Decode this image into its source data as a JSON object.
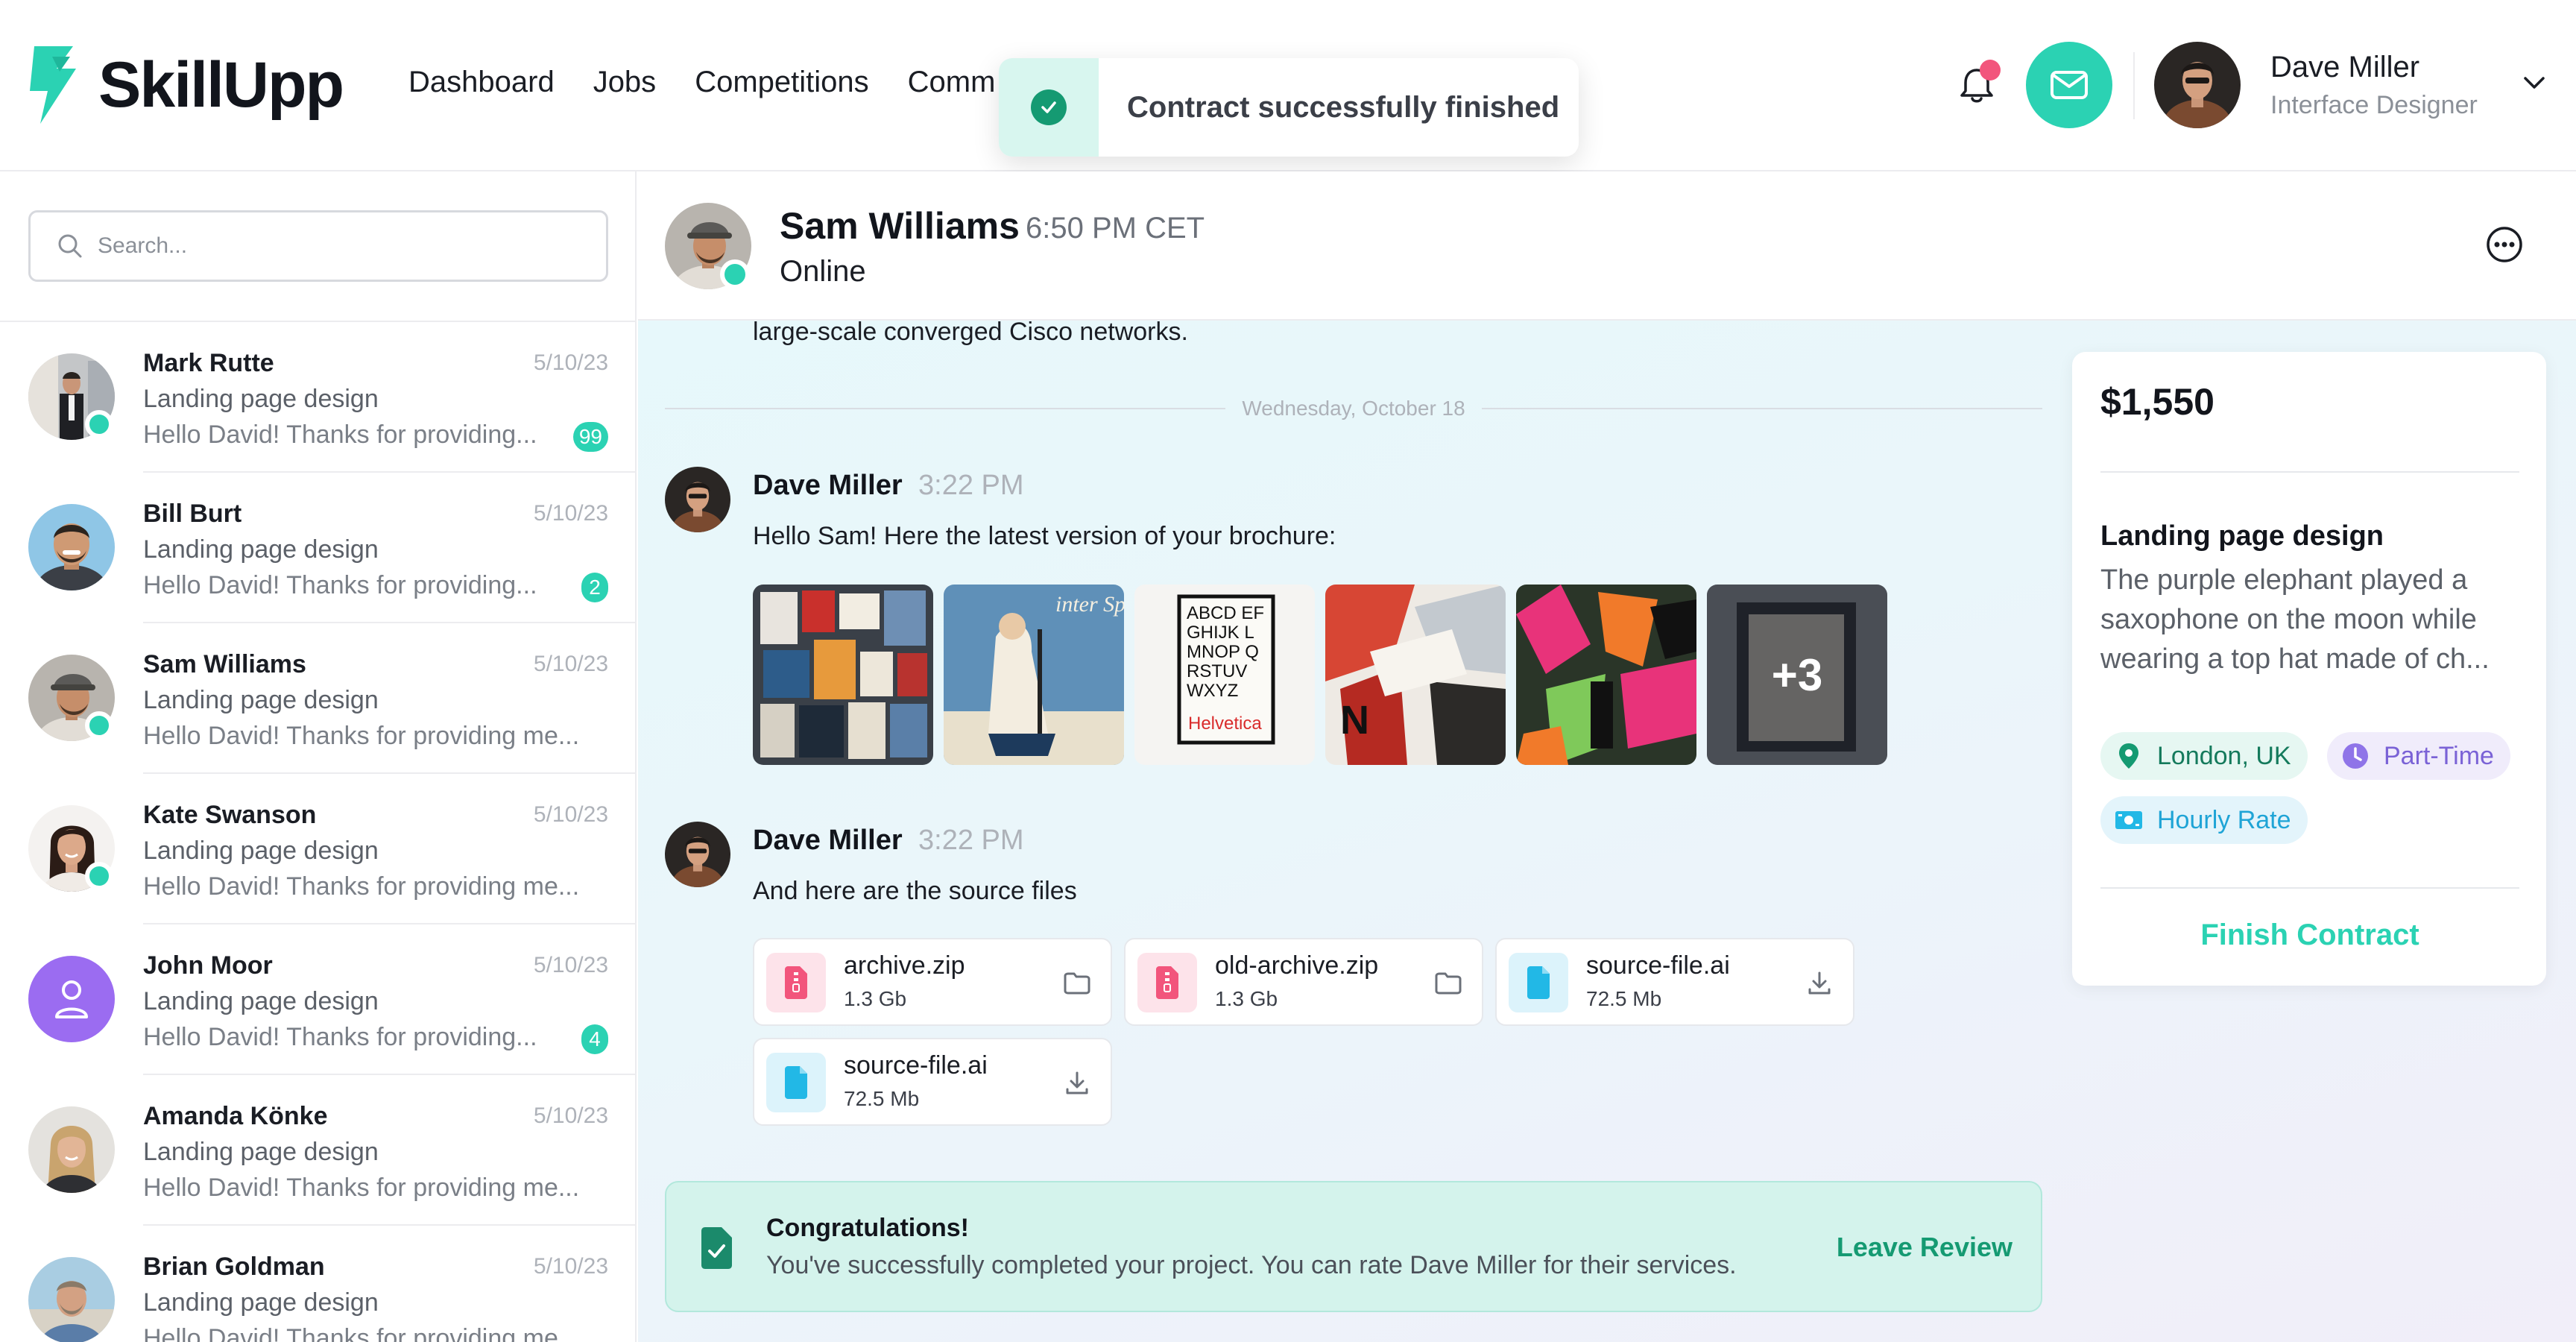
{
  "brand": {
    "name": "SkillUpp",
    "accent": "#2bd2b3",
    "accent_dark": "#159a72"
  },
  "nav": {
    "items": [
      "Dashboard",
      "Jobs",
      "Competitions",
      "Comm"
    ]
  },
  "toast": {
    "message": "Contract successfully finished"
  },
  "user": {
    "name": "Dave Miller",
    "role": "Interface Designer"
  },
  "sidebar": {
    "search_placeholder": "Search...",
    "conversations": [
      {
        "name": "Mark Rutte",
        "date": "5/10/23",
        "subject": "Landing page design",
        "preview": "Hello David! Thanks for providing...",
        "badge": "99",
        "online": true
      },
      {
        "name": "Bill Burt",
        "date": "5/10/23",
        "subject": "Landing page design",
        "preview": "Hello David! Thanks for providing...",
        "badge": "2",
        "online": false
      },
      {
        "name": "Sam Williams",
        "date": "5/10/23",
        "subject": "Landing page design",
        "preview": "Hello David! Thanks for providing me...",
        "badge": "",
        "online": true
      },
      {
        "name": "Kate Swanson",
        "date": "5/10/23",
        "subject": "Landing page design",
        "preview": "Hello David! Thanks for providing me...",
        "badge": "",
        "online": true
      },
      {
        "name": "John Moor",
        "date": "5/10/23",
        "subject": "Landing page design",
        "preview": "Hello David! Thanks for providing...",
        "badge": "4",
        "online": false
      },
      {
        "name": "Amanda Könke",
        "date": "5/10/23",
        "subject": "Landing page design",
        "preview": "Hello David! Thanks for providing me...",
        "badge": "",
        "online": false
      },
      {
        "name": "Brian Goldman",
        "date": "5/10/23",
        "subject": "Landing page design",
        "preview": "Hello David! Thanks for providing me...",
        "badge": "",
        "online": false
      }
    ]
  },
  "chat": {
    "contact_name": "Sam Williams",
    "contact_time": "6:50 PM CET",
    "contact_status": "Online",
    "clipped_text": "large-scale converged Cisco networks.",
    "day_separator": "Wednesday, October 18",
    "messages": [
      {
        "author": "Dave Miller",
        "time": "3:22 PM",
        "text": "Hello Sam! Here the latest version of your brochure:",
        "more_images": "+3"
      },
      {
        "author": "Dave Miller",
        "time": "3:22 PM",
        "text": "And here are the source files"
      }
    ],
    "files": [
      {
        "name": "archive.zip",
        "size": "1.3 Gb",
        "action": "folder-icon"
      },
      {
        "name": "old-archive.zip",
        "size": "1.3 Gb",
        "action": "folder-icon"
      },
      {
        "name": "source-file.ai",
        "size": "72.5 Mb",
        "action": "download-icon"
      },
      {
        "name": "source-file.ai",
        "size": "72.5 Mb",
        "action": "download-icon"
      }
    ],
    "thumb_texts": {
      "sports": "inter Sports",
      "type_poster": "ABCD EFGHIJK LMNOP QRSTUV WXYZ",
      "type_brand": "Helvetica"
    },
    "congrats": {
      "title": "Congratulations!",
      "text": "You've successfully completed your project. You can rate Dave Miller for their services.",
      "action": "Leave Review"
    }
  },
  "contract": {
    "price": "$1,550",
    "title": "Landing page design",
    "description": "The purple elephant played a saxophone on the moon while wearing a top hat made of ch...",
    "tags": {
      "location": "London, UK",
      "type": "Part-Time",
      "rate": "Hourly Rate"
    },
    "action": "Finish Contract"
  }
}
